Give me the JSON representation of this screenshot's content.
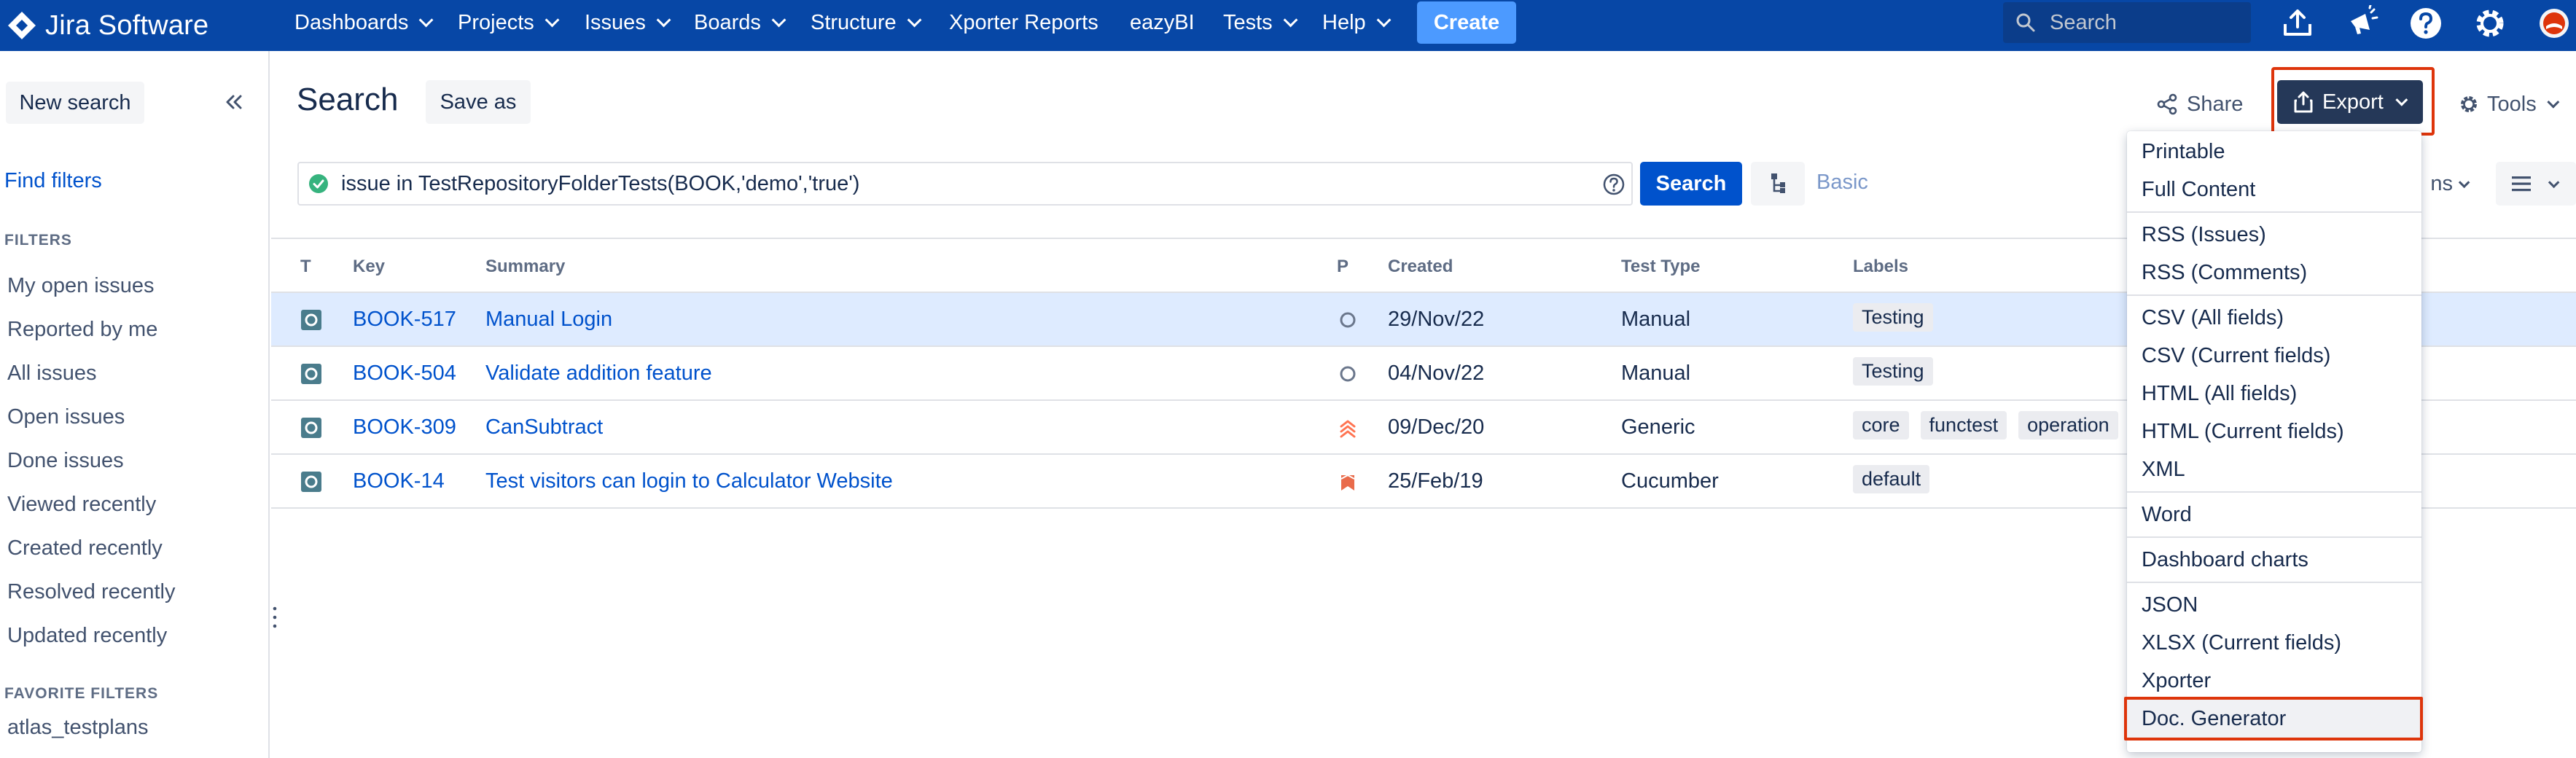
{
  "app": {
    "name": "Jira Software"
  },
  "topnav": {
    "items": [
      {
        "label": "Dashboards",
        "has_menu": true
      },
      {
        "label": "Projects",
        "has_menu": true
      },
      {
        "label": "Issues",
        "has_menu": true
      },
      {
        "label": "Boards",
        "has_menu": true
      },
      {
        "label": "Structure",
        "has_menu": true
      },
      {
        "label": "Xporter Reports",
        "has_menu": false
      },
      {
        "label": "eazyBI",
        "has_menu": false
      },
      {
        "label": "Tests",
        "has_menu": true
      },
      {
        "label": "Help",
        "has_menu": true
      }
    ],
    "create_label": "Create",
    "search_placeholder": "Search",
    "icons": [
      "upload-icon",
      "notifications-icon",
      "help-icon",
      "settings-icon",
      "avatar"
    ]
  },
  "sidebar": {
    "new_search": "New search",
    "find_filters": "Find filters",
    "filters_heading": "FILTERS",
    "filters": [
      "My open issues",
      "Reported by me",
      "All issues",
      "Open issues",
      "Done issues",
      "Viewed recently",
      "Created recently",
      "Resolved recently",
      "Updated recently"
    ],
    "favorite_heading": "FAVORITE FILTERS",
    "favorites": [
      "atlas_testplans"
    ]
  },
  "main": {
    "title": "Search",
    "save_as": "Save as",
    "share": "Share",
    "export": "Export",
    "tools": "Tools",
    "jql": "issue in TestRepositoryFolderTests(BOOK,'demo','true')",
    "search_button": "Search",
    "basic": "Basic",
    "columns_partial": "ns"
  },
  "table": {
    "headers": {
      "type": "T",
      "key": "Key",
      "summary": "Summary",
      "priority": "P",
      "created": "Created",
      "test_type": "Test Type",
      "labels": "Labels"
    },
    "rows": [
      {
        "key": "BOOK-517",
        "summary": "Manual Login",
        "priority": "none",
        "created": "29/Nov/22",
        "test_type": "Manual",
        "labels": [
          "Testing"
        ],
        "selected": true
      },
      {
        "key": "BOOK-504",
        "summary": "Validate addition feature",
        "priority": "none",
        "created": "04/Nov/22",
        "test_type": "Manual",
        "labels": [
          "Testing"
        ],
        "selected": false
      },
      {
        "key": "BOOK-309",
        "summary": "CanSubtract",
        "priority": "highest",
        "created": "09/Dec/20",
        "test_type": "Generic",
        "labels": [
          "core",
          "functest",
          "operation"
        ],
        "selected": false
      },
      {
        "key": "BOOK-14",
        "summary": "Test visitors can login to Calculator Website",
        "priority": "blocker",
        "created": "25/Feb/19",
        "test_type": "Cucumber",
        "labels": [
          "default"
        ],
        "selected": false
      }
    ]
  },
  "export_menu": {
    "groups": [
      [
        "Printable",
        "Full Content"
      ],
      [
        "RSS (Issues)",
        "RSS (Comments)"
      ],
      [
        "CSV (All fields)",
        "CSV (Current fields)",
        "HTML (All fields)",
        "HTML (Current fields)",
        "XML"
      ],
      [
        "Word"
      ],
      [
        "Dashboard charts"
      ],
      [
        "JSON",
        "XLSX (Current fields)",
        "Xporter",
        "Doc. Generator"
      ]
    ],
    "highlighted": "Doc. Generator"
  },
  "colors": {
    "nav_bg": "#0747a6",
    "primary": "#0052cc",
    "create": "#4c9aff",
    "highlight_border": "#de350b",
    "selected_row": "#deebff",
    "test_icon": "#4a7c8c",
    "priority_high": "#ff7452",
    "priority_blocker": "#e96b4b"
  }
}
